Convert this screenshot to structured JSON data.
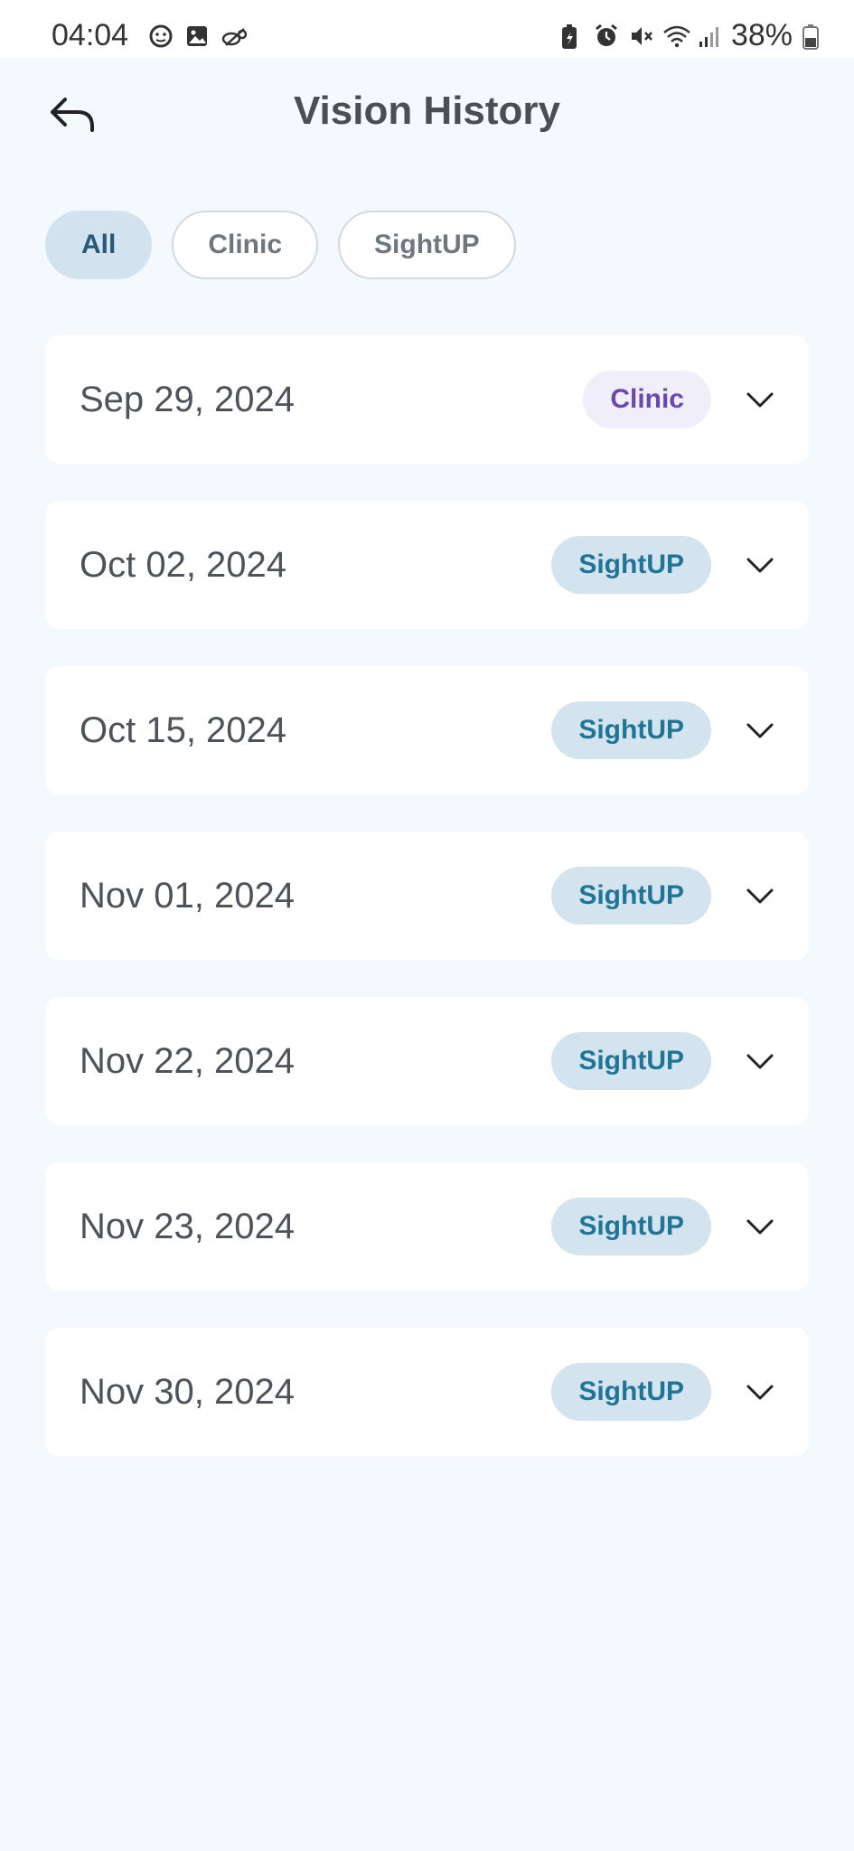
{
  "status_bar": {
    "time": "04:04",
    "battery": "38%",
    "left_icons": [
      "face-icon",
      "image-icon",
      "link-icon"
    ],
    "right_icons": [
      "battery-saver-icon",
      "alarm-icon",
      "mute-icon",
      "wifi-icon",
      "signal-icon",
      "battery-icon"
    ]
  },
  "header": {
    "title": "Vision History",
    "back_icon": "back-arrow-icon"
  },
  "filters": [
    {
      "label": "All",
      "active": true
    },
    {
      "label": "Clinic",
      "active": false
    },
    {
      "label": "SightUP",
      "active": false
    }
  ],
  "history": [
    {
      "date": "Sep 29, 2024",
      "tag": "Clinic"
    },
    {
      "date": "Oct 02, 2024",
      "tag": "SightUP"
    },
    {
      "date": "Oct 15, 2024",
      "tag": "SightUP"
    },
    {
      "date": "Nov 01, 2024",
      "tag": "SightUP"
    },
    {
      "date": "Nov 22, 2024",
      "tag": "SightUP"
    },
    {
      "date": "Nov 23, 2024",
      "tag": "SightUP"
    },
    {
      "date": "Nov 30, 2024",
      "tag": "SightUP"
    }
  ],
  "colors": {
    "background": "#f4f9fd",
    "chip_active": "#d2e3ef",
    "clinic_tag_bg": "#f1eefb",
    "clinic_tag_text": "#6a49ad",
    "sightup_tag_bg": "#d3e4ee",
    "sightup_tag_text": "#1f7597"
  }
}
